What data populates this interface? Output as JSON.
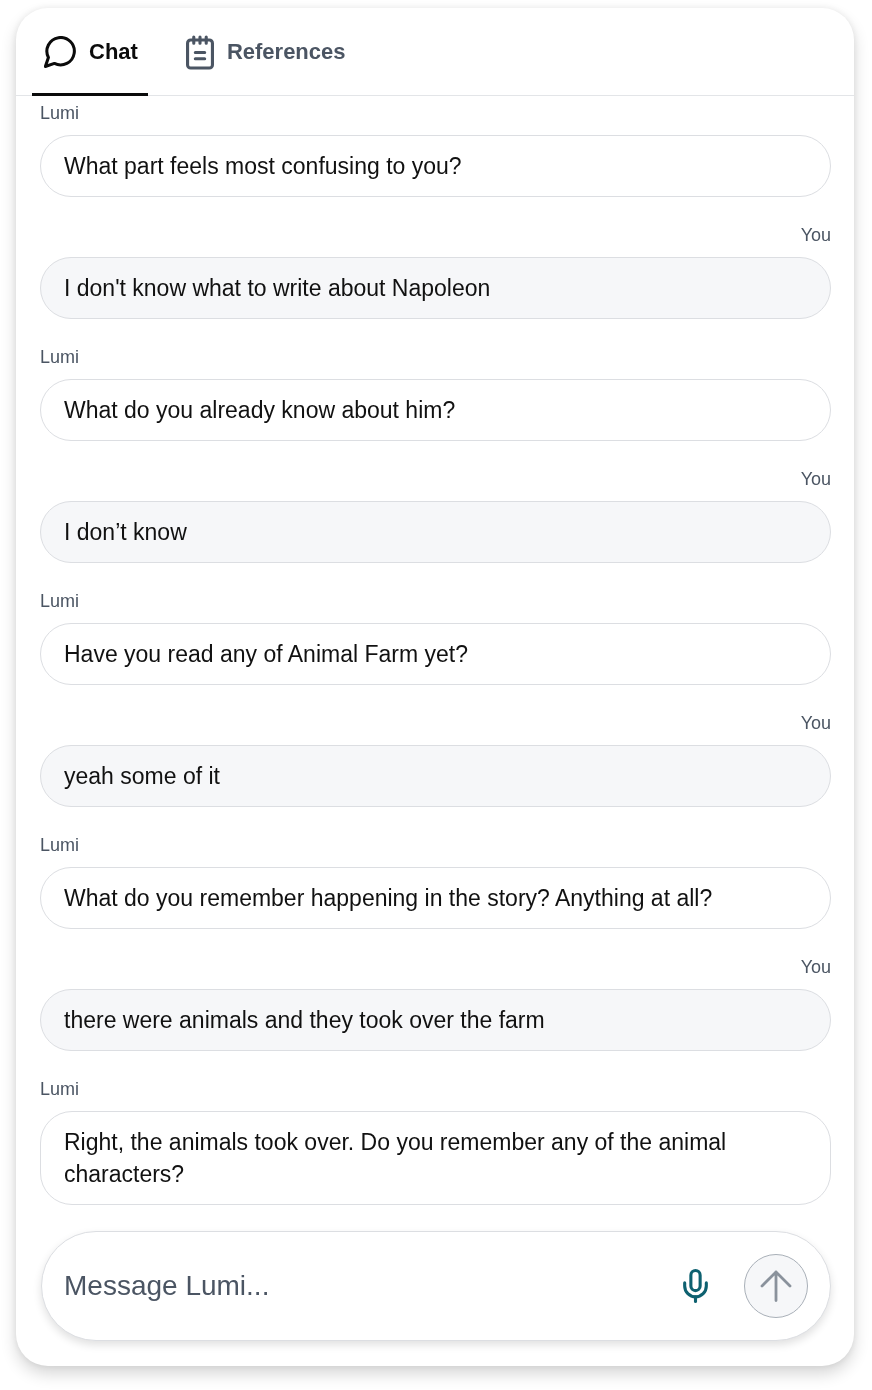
{
  "tabs": [
    {
      "kind": "chat",
      "label": "Chat",
      "selected": true
    },
    {
      "kind": "notes",
      "label": "References",
      "selected": false
    }
  ],
  "messages": [
    {
      "kind": "assistant",
      "sender": "Lumi",
      "text": "What part feels most confusing to you?"
    },
    {
      "kind": "user",
      "sender": "You",
      "text": "I don't know what to write about Napoleon"
    },
    {
      "kind": "assistant",
      "sender": "Lumi",
      "text": "What do you already know about him?"
    },
    {
      "kind": "user",
      "sender": "You",
      "text": "I don’t know"
    },
    {
      "kind": "assistant",
      "sender": "Lumi",
      "text": "Have you read any of Animal Farm yet?"
    },
    {
      "kind": "user",
      "sender": "You",
      "text": "yeah some of it"
    },
    {
      "kind": "assistant",
      "sender": "Lumi",
      "text": "What do you remember happening in the story? Anything at all?"
    },
    {
      "kind": "user",
      "sender": "You",
      "text": "there were animals and they took over the farm"
    },
    {
      "kind": "assistant",
      "sender": "Lumi",
      "text": "Right, the animals took over. Do you remember any of the animal characters?"
    }
  ],
  "composer": {
    "placeholder": "Message Lumi...",
    "send_button": {
      "disabled": true
    }
  }
}
